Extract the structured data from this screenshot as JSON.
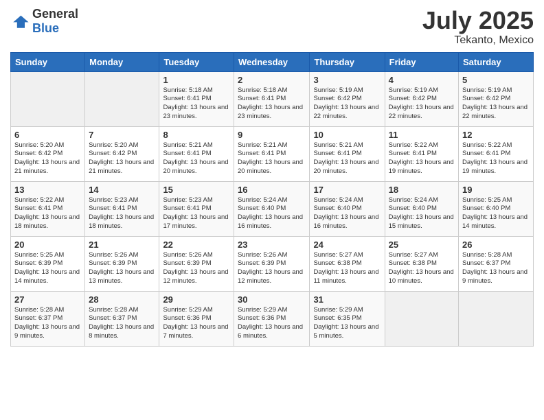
{
  "header": {
    "logo_general": "General",
    "logo_blue": "Blue",
    "title": "July 2025",
    "location": "Tekanto, Mexico"
  },
  "days_of_week": [
    "Sunday",
    "Monday",
    "Tuesday",
    "Wednesday",
    "Thursday",
    "Friday",
    "Saturday"
  ],
  "weeks": [
    [
      {
        "day": "",
        "sunrise": "",
        "sunset": "",
        "daylight": ""
      },
      {
        "day": "",
        "sunrise": "",
        "sunset": "",
        "daylight": ""
      },
      {
        "day": "1",
        "sunrise": "Sunrise: 5:18 AM",
        "sunset": "Sunset: 6:41 PM",
        "daylight": "Daylight: 13 hours and 23 minutes."
      },
      {
        "day": "2",
        "sunrise": "Sunrise: 5:18 AM",
        "sunset": "Sunset: 6:41 PM",
        "daylight": "Daylight: 13 hours and 23 minutes."
      },
      {
        "day": "3",
        "sunrise": "Sunrise: 5:19 AM",
        "sunset": "Sunset: 6:42 PM",
        "daylight": "Daylight: 13 hours and 22 minutes."
      },
      {
        "day": "4",
        "sunrise": "Sunrise: 5:19 AM",
        "sunset": "Sunset: 6:42 PM",
        "daylight": "Daylight: 13 hours and 22 minutes."
      },
      {
        "day": "5",
        "sunrise": "Sunrise: 5:19 AM",
        "sunset": "Sunset: 6:42 PM",
        "daylight": "Daylight: 13 hours and 22 minutes."
      }
    ],
    [
      {
        "day": "6",
        "sunrise": "Sunrise: 5:20 AM",
        "sunset": "Sunset: 6:42 PM",
        "daylight": "Daylight: 13 hours and 21 minutes."
      },
      {
        "day": "7",
        "sunrise": "Sunrise: 5:20 AM",
        "sunset": "Sunset: 6:42 PM",
        "daylight": "Daylight: 13 hours and 21 minutes."
      },
      {
        "day": "8",
        "sunrise": "Sunrise: 5:21 AM",
        "sunset": "Sunset: 6:41 PM",
        "daylight": "Daylight: 13 hours and 20 minutes."
      },
      {
        "day": "9",
        "sunrise": "Sunrise: 5:21 AM",
        "sunset": "Sunset: 6:41 PM",
        "daylight": "Daylight: 13 hours and 20 minutes."
      },
      {
        "day": "10",
        "sunrise": "Sunrise: 5:21 AM",
        "sunset": "Sunset: 6:41 PM",
        "daylight": "Daylight: 13 hours and 20 minutes."
      },
      {
        "day": "11",
        "sunrise": "Sunrise: 5:22 AM",
        "sunset": "Sunset: 6:41 PM",
        "daylight": "Daylight: 13 hours and 19 minutes."
      },
      {
        "day": "12",
        "sunrise": "Sunrise: 5:22 AM",
        "sunset": "Sunset: 6:41 PM",
        "daylight": "Daylight: 13 hours and 19 minutes."
      }
    ],
    [
      {
        "day": "13",
        "sunrise": "Sunrise: 5:22 AM",
        "sunset": "Sunset: 6:41 PM",
        "daylight": "Daylight: 13 hours and 18 minutes."
      },
      {
        "day": "14",
        "sunrise": "Sunrise: 5:23 AM",
        "sunset": "Sunset: 6:41 PM",
        "daylight": "Daylight: 13 hours and 18 minutes."
      },
      {
        "day": "15",
        "sunrise": "Sunrise: 5:23 AM",
        "sunset": "Sunset: 6:41 PM",
        "daylight": "Daylight: 13 hours and 17 minutes."
      },
      {
        "day": "16",
        "sunrise": "Sunrise: 5:24 AM",
        "sunset": "Sunset: 6:40 PM",
        "daylight": "Daylight: 13 hours and 16 minutes."
      },
      {
        "day": "17",
        "sunrise": "Sunrise: 5:24 AM",
        "sunset": "Sunset: 6:40 PM",
        "daylight": "Daylight: 13 hours and 16 minutes."
      },
      {
        "day": "18",
        "sunrise": "Sunrise: 5:24 AM",
        "sunset": "Sunset: 6:40 PM",
        "daylight": "Daylight: 13 hours and 15 minutes."
      },
      {
        "day": "19",
        "sunrise": "Sunrise: 5:25 AM",
        "sunset": "Sunset: 6:40 PM",
        "daylight": "Daylight: 13 hours and 14 minutes."
      }
    ],
    [
      {
        "day": "20",
        "sunrise": "Sunrise: 5:25 AM",
        "sunset": "Sunset: 6:39 PM",
        "daylight": "Daylight: 13 hours and 14 minutes."
      },
      {
        "day": "21",
        "sunrise": "Sunrise: 5:26 AM",
        "sunset": "Sunset: 6:39 PM",
        "daylight": "Daylight: 13 hours and 13 minutes."
      },
      {
        "day": "22",
        "sunrise": "Sunrise: 5:26 AM",
        "sunset": "Sunset: 6:39 PM",
        "daylight": "Daylight: 13 hours and 12 minutes."
      },
      {
        "day": "23",
        "sunrise": "Sunrise: 5:26 AM",
        "sunset": "Sunset: 6:39 PM",
        "daylight": "Daylight: 13 hours and 12 minutes."
      },
      {
        "day": "24",
        "sunrise": "Sunrise: 5:27 AM",
        "sunset": "Sunset: 6:38 PM",
        "daylight": "Daylight: 13 hours and 11 minutes."
      },
      {
        "day": "25",
        "sunrise": "Sunrise: 5:27 AM",
        "sunset": "Sunset: 6:38 PM",
        "daylight": "Daylight: 13 hours and 10 minutes."
      },
      {
        "day": "26",
        "sunrise": "Sunrise: 5:28 AM",
        "sunset": "Sunset: 6:37 PM",
        "daylight": "Daylight: 13 hours and 9 minutes."
      }
    ],
    [
      {
        "day": "27",
        "sunrise": "Sunrise: 5:28 AM",
        "sunset": "Sunset: 6:37 PM",
        "daylight": "Daylight: 13 hours and 9 minutes."
      },
      {
        "day": "28",
        "sunrise": "Sunrise: 5:28 AM",
        "sunset": "Sunset: 6:37 PM",
        "daylight": "Daylight: 13 hours and 8 minutes."
      },
      {
        "day": "29",
        "sunrise": "Sunrise: 5:29 AM",
        "sunset": "Sunset: 6:36 PM",
        "daylight": "Daylight: 13 hours and 7 minutes."
      },
      {
        "day": "30",
        "sunrise": "Sunrise: 5:29 AM",
        "sunset": "Sunset: 6:36 PM",
        "daylight": "Daylight: 13 hours and 6 minutes."
      },
      {
        "day": "31",
        "sunrise": "Sunrise: 5:29 AM",
        "sunset": "Sunset: 6:35 PM",
        "daylight": "Daylight: 13 hours and 5 minutes."
      },
      {
        "day": "",
        "sunrise": "",
        "sunset": "",
        "daylight": ""
      },
      {
        "day": "",
        "sunrise": "",
        "sunset": "",
        "daylight": ""
      }
    ]
  ]
}
